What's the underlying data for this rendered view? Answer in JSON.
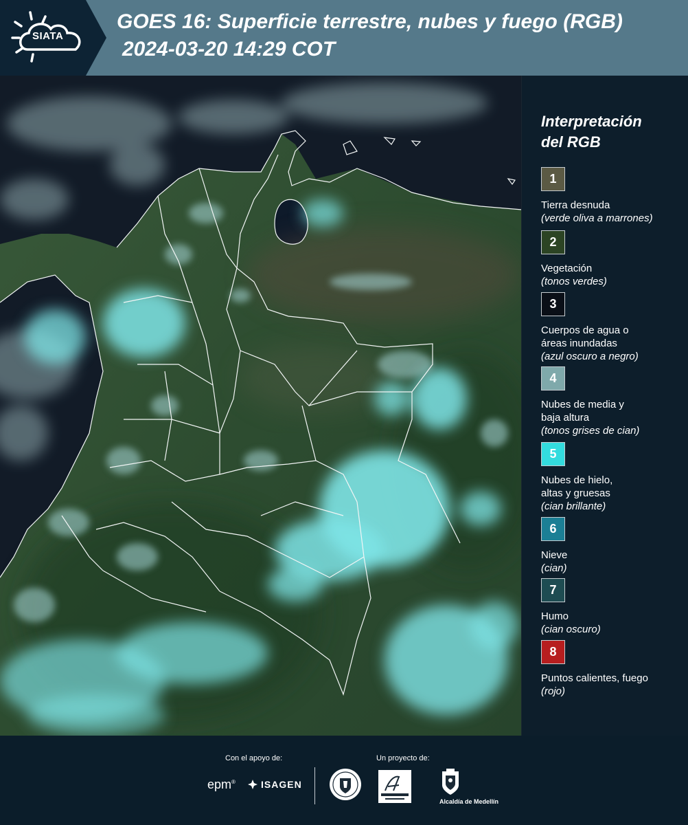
{
  "header": {
    "logo_text": "SIATA",
    "title": "GOES 16: Superficie terrestre, nubes y fuego (RGB)",
    "subtitle": "2024-03-20 14:29 COT"
  },
  "legend": {
    "title_line1": "Interpretación",
    "title_line2": "del RGB",
    "items": [
      {
        "num": "1",
        "color": "#5b5a44",
        "label": "Tierra desnuda",
        "desc": "(verde oliva a marrones)"
      },
      {
        "num": "2",
        "color": "#2c4424",
        "label": "Vegetación",
        "desc": "(tonos verdes)"
      },
      {
        "num": "3",
        "color": "#0a0f17",
        "label": "Cuerpos de agua o áreas inundadas",
        "desc": "(azul oscuro a negro)"
      },
      {
        "num": "4",
        "color": "#7fa9ab",
        "label": "Nubes de media y baja altura",
        "desc": "(tonos grises de cian)"
      },
      {
        "num": "5",
        "color": "#33dcde",
        "label": "Nubes de hielo, altas y gruesas",
        "desc": "(cian brillante)"
      },
      {
        "num": "6",
        "color": "#1b7f95",
        "label": "Nieve",
        "desc": "(cian)"
      },
      {
        "num": "7",
        "color": "#1e4c52",
        "label": "Humo",
        "desc": "(cian oscuro)"
      },
      {
        "num": "8",
        "color": "#b71e1f",
        "label": "Puntos calientes, fuego",
        "desc": "(rojo)"
      }
    ]
  },
  "footer": {
    "support_caption": "Con el apoyo de:",
    "project_caption": "Un proyecto de:",
    "epm": "epm",
    "isagen": "ISAGEN",
    "medellin": "Alcaldía de Medellín"
  }
}
